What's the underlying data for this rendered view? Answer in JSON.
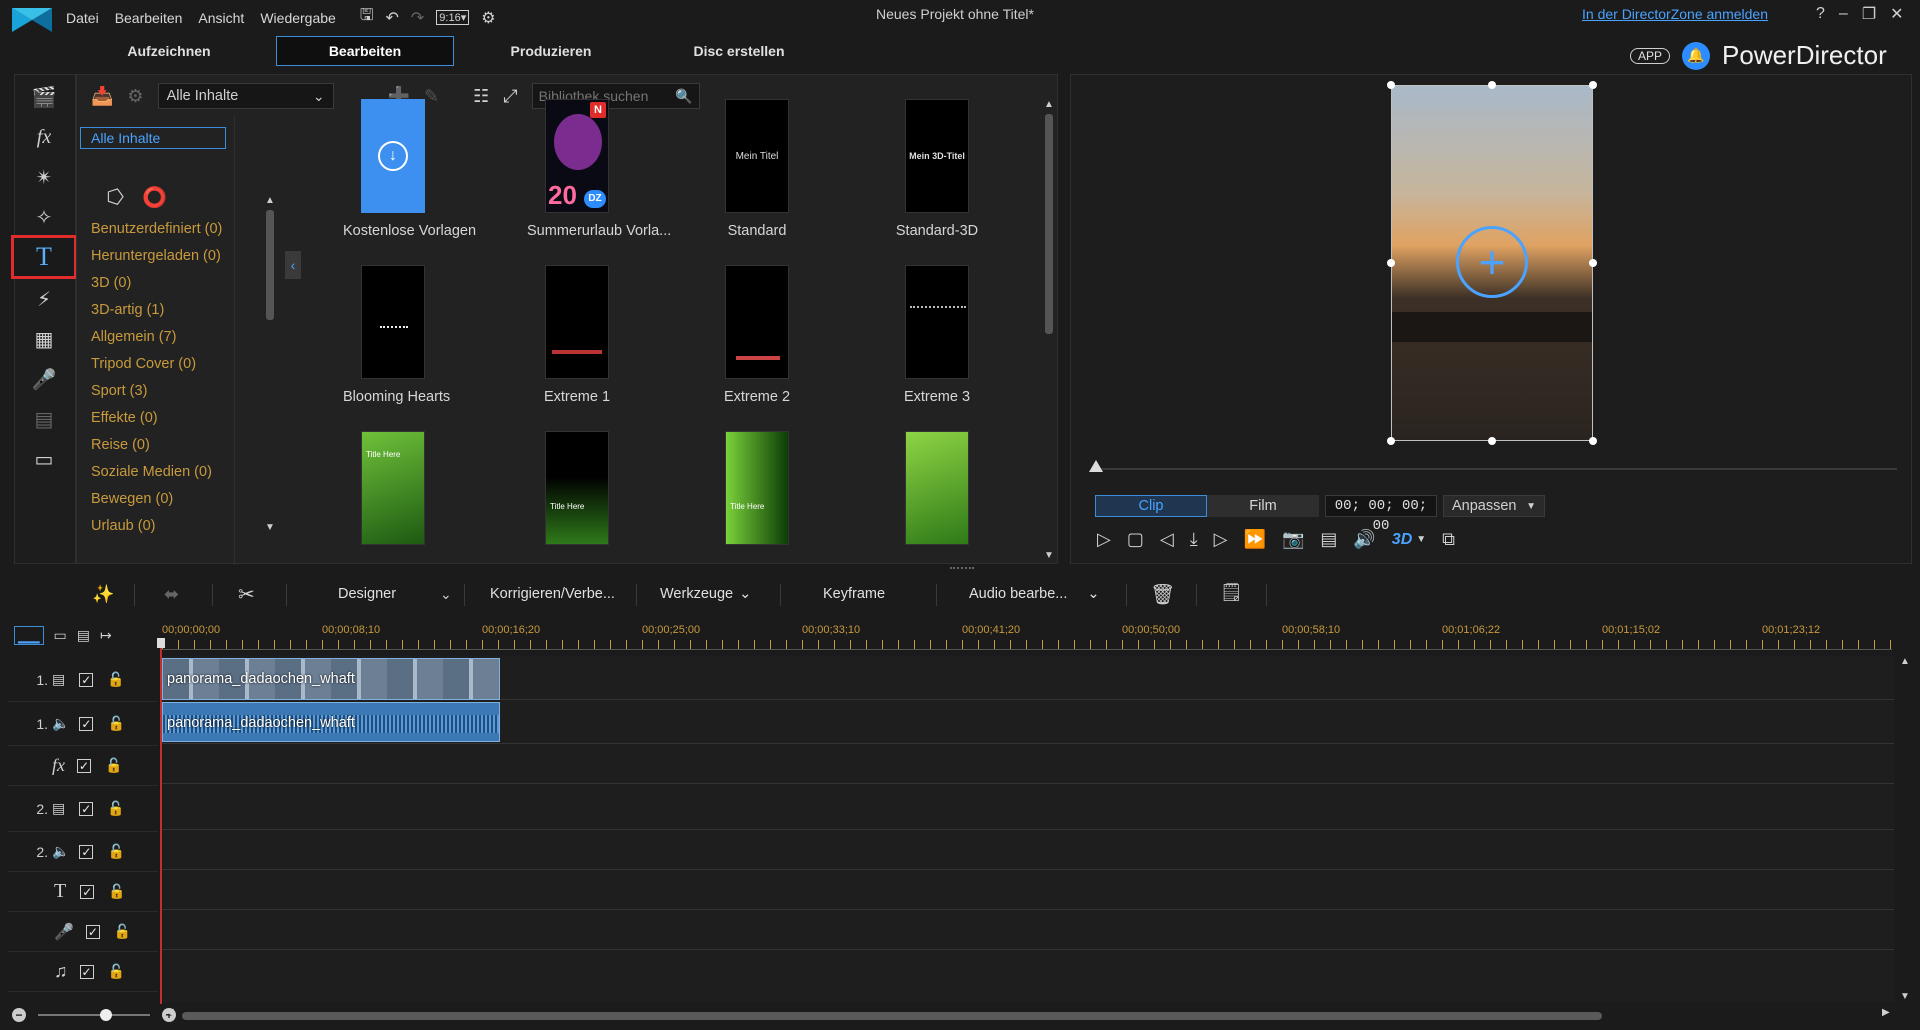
{
  "menu": [
    "Datei",
    "Bearbeiten",
    "Ansicht",
    "Wiedergabe"
  ],
  "window_title": "Neues Projekt ohne Titel*",
  "directorzone_link": "In der DirectorZone anmelden",
  "aspect_ratio": "9:16",
  "app_badge": "APP",
  "app_name": "PowerDirector",
  "mode_tabs": [
    "Aufzeichnen",
    "Bearbeiten",
    "Produzieren",
    "Disc erstellen"
  ],
  "library": {
    "filter_value": "Alle Inhalte",
    "search_placeholder": "Bibliothek suchen",
    "selected_tag": "Alle Inhalte",
    "categories": [
      "Benutzerdefiniert  (0)",
      "Heruntergeladen  (0)",
      "3D  (0)",
      "3D-artig  (1)",
      "Allgemein  (7)",
      "Tripod Cover  (0)",
      "Sport  (3)",
      "Effekte  (0)",
      "Reise  (0)",
      "Soziale Medien  (0)",
      "Bewegen  (0)",
      "Urlaub  (0)"
    ],
    "templates": [
      {
        "label": "Kostenlose Vorlagen",
        "inner": ""
      },
      {
        "label": "Summerurlaub Vorla...",
        "inner": "20"
      },
      {
        "label": "Standard",
        "inner": "Mein Titel"
      },
      {
        "label": "Standard-3D",
        "inner": "Mein 3D-Titel"
      },
      {
        "label": "Blooming Hearts",
        "inner": ""
      },
      {
        "label": "Extreme 1",
        "inner": ""
      },
      {
        "label": "Extreme 2",
        "inner": ""
      },
      {
        "label": "Extreme 3",
        "inner": ""
      },
      {
        "label": "",
        "inner": "Title Here"
      },
      {
        "label": "",
        "inner": "Title Here"
      },
      {
        "label": "",
        "inner": "Title Here"
      },
      {
        "label": "",
        "inner": ""
      }
    ],
    "badge_new": "N",
    "badge_dz": "DZ"
  },
  "preview": {
    "clip_tab": "Clip",
    "film_tab": "Film",
    "timecode": "00; 00; 00; 00",
    "fit_label": "Anpassen",
    "three_d": "3D"
  },
  "edit_toolbar": {
    "designer": "Designer",
    "fix": "Korrigieren/Verbe...",
    "tools": "Werkzeuge",
    "keyframe": "Keyframe",
    "audio": "Audio bearbe..."
  },
  "timeline": {
    "ruler": [
      "00;00;00;00",
      "00;00;08;10",
      "00;00;16;20",
      "00;00;25;00",
      "00;00;33;10",
      "00;00;41;20",
      "00;00;50;00",
      "00;00;58;10",
      "00;01;06;22",
      "00;01;15;02",
      "00;01;23;12"
    ],
    "tracks": [
      {
        "num": "1.",
        "type": "video"
      },
      {
        "num": "1.",
        "type": "audio"
      },
      {
        "num": "",
        "type": "fx"
      },
      {
        "num": "2.",
        "type": "video"
      },
      {
        "num": "2.",
        "type": "audio"
      },
      {
        "num": "",
        "type": "title"
      },
      {
        "num": "",
        "type": "voice"
      },
      {
        "num": "",
        "type": "music"
      }
    ],
    "clip_video": "panorama_dadaochen_whaft",
    "clip_audio": "panorama_dadaochen_whaft"
  },
  "colors": {
    "accent": "#3c8ed8",
    "category": "#c89a3c",
    "highlight_red": "#e22b2b"
  }
}
